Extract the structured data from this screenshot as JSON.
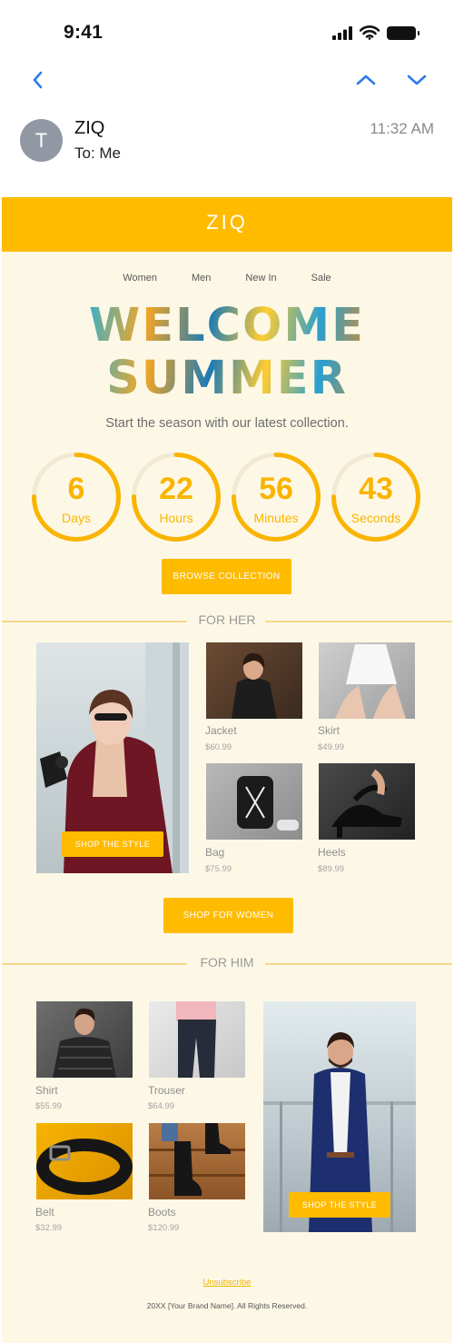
{
  "status_bar": {
    "time": "9:41",
    "icons": [
      "signal-icon",
      "wifi-icon",
      "battery-icon"
    ]
  },
  "mail_nav": {
    "icons": [
      "chevron-left-icon",
      "chevron-up-icon",
      "chevron-down-icon"
    ],
    "accent": "#2f7bea"
  },
  "message": {
    "avatar_initial": "T",
    "sender": "ZIQ",
    "recipient": "To: Me",
    "time": "11:32 AM"
  },
  "email": {
    "brand": "ZIQ",
    "menu": [
      "Women",
      "Men",
      "New In",
      "Sale"
    ],
    "headline_line1": "WELCOME",
    "headline_line2": "SUMMER",
    "tagline": "Start the season with our latest collection.",
    "countdown": [
      {
        "value": "6",
        "label": "Days",
        "progress": 0.75
      },
      {
        "value": "22",
        "label": "Hours",
        "progress": 0.75
      },
      {
        "value": "56",
        "label": "Minutes",
        "progress": 0.75
      },
      {
        "value": "43",
        "label": "Seconds",
        "progress": 0.75
      }
    ],
    "browse_button": "BROWSE COLLECTION",
    "for_her": {
      "heading": "FOR HER",
      "hero_button": "SHOP THE STYLE",
      "products": [
        {
          "name": "Jacket",
          "price": "$60.99"
        },
        {
          "name": "Skirt",
          "price": "$49.99"
        },
        {
          "name": "Bag",
          "price": "$75.99"
        },
        {
          "name": "Heels",
          "price": "$89.99"
        }
      ],
      "shop_button": "SHOP FOR WOMEN"
    },
    "for_him": {
      "heading": "FOR HIM",
      "hero_button": "SHOP THE STYLE",
      "products": [
        {
          "name": "Shirt",
          "price": "$55.99"
        },
        {
          "name": "Trouser",
          "price": "$64.99"
        },
        {
          "name": "Belt",
          "price": "$32.99"
        },
        {
          "name": "Boots",
          "price": "$120.99"
        }
      ]
    },
    "unsubscribe": "Unsubscribe",
    "copyright": "20XX [Your Brand Name]. All Rights Reserved."
  },
  "colors": {
    "brand_yellow": "#ffbb00",
    "cream": "#fdf8e6",
    "accent_blue": "#2f7bea"
  }
}
